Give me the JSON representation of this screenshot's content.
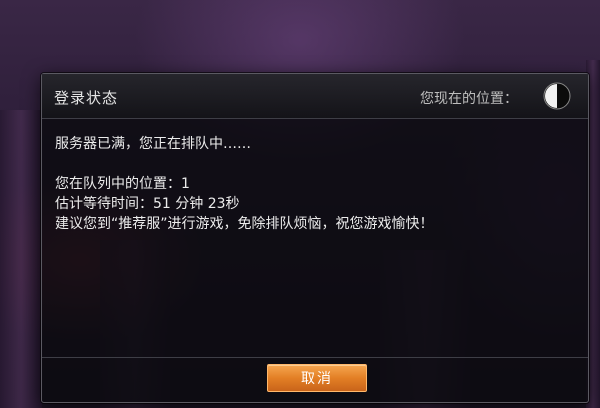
{
  "dialog": {
    "title": "登录状态",
    "position_label": "您现在的位置：",
    "queue_icon": "half-filled-circle-icon",
    "message_full": "服务器已满，您正在排队中……",
    "queue_position": "您在队列中的位置：1",
    "wait_time": "估计等待时间：51 分钟 23秒",
    "suggestion": "建议您到“推荐服”进行游戏，免除排队烦恼，祝您游戏愉快！",
    "cancel_label": "取消"
  },
  "colors": {
    "button_orange": "#e37f25",
    "dialog_bg": "#0a0a0e",
    "text": "#ececec"
  }
}
